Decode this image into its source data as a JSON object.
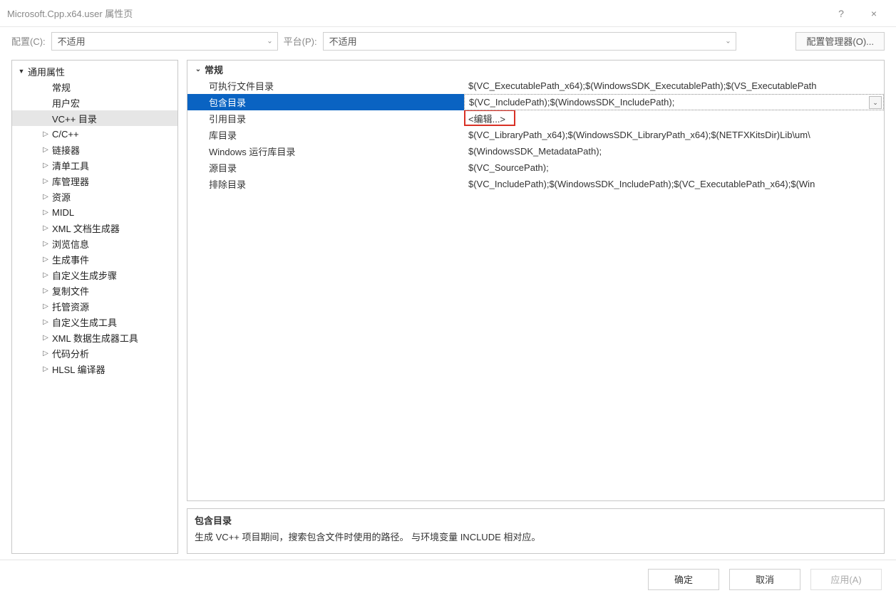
{
  "titlebar": {
    "title": "Microsoft.Cpp.x64.user 属性页",
    "help_icon": "?",
    "close_icon": "×"
  },
  "toolbar": {
    "config_label": "配置(C):",
    "config_value": "不适用",
    "platform_label": "平台(P):",
    "platform_value": "不适用",
    "config_manager": "配置管理器(O)..."
  },
  "tree": {
    "root": {
      "label": "通用属性",
      "expanded": true
    },
    "items": [
      {
        "label": "常规",
        "level": 2,
        "toggle": ""
      },
      {
        "label": "用户宏",
        "level": 2,
        "toggle": ""
      },
      {
        "label": "VC++ 目录",
        "level": 2,
        "toggle": "",
        "selected": true
      },
      {
        "label": "C/C++",
        "level": 2,
        "toggle": "▷"
      },
      {
        "label": "链接器",
        "level": 2,
        "toggle": "▷"
      },
      {
        "label": "清单工具",
        "level": 2,
        "toggle": "▷"
      },
      {
        "label": "库管理器",
        "level": 2,
        "toggle": "▷"
      },
      {
        "label": "资源",
        "level": 2,
        "toggle": "▷"
      },
      {
        "label": "MIDL",
        "level": 2,
        "toggle": "▷"
      },
      {
        "label": "XML 文档生成器",
        "level": 2,
        "toggle": "▷"
      },
      {
        "label": "浏览信息",
        "level": 2,
        "toggle": "▷"
      },
      {
        "label": "生成事件",
        "level": 2,
        "toggle": "▷"
      },
      {
        "label": "自定义生成步骤",
        "level": 2,
        "toggle": "▷"
      },
      {
        "label": "复制文件",
        "level": 2,
        "toggle": "▷"
      },
      {
        "label": "托管资源",
        "level": 2,
        "toggle": "▷"
      },
      {
        "label": "自定义生成工具",
        "level": 2,
        "toggle": "▷"
      },
      {
        "label": "XML 数据生成器工具",
        "level": 2,
        "toggle": "▷"
      },
      {
        "label": "代码分析",
        "level": 2,
        "toggle": "▷"
      },
      {
        "label": "HLSL 编译器",
        "level": 2,
        "toggle": "▷"
      }
    ]
  },
  "grid": {
    "category": "常规",
    "rows": [
      {
        "name": "可执行文件目录",
        "value": "$(VC_ExecutablePath_x64);$(WindowsSDK_ExecutablePath);$(VS_ExecutablePath"
      },
      {
        "name": "包含目录",
        "value": "$(VC_IncludePath);$(WindowsSDK_IncludePath);",
        "selected": true
      },
      {
        "name": "引用目录",
        "value": "<编辑...>",
        "edit_highlight": true
      },
      {
        "name": "库目录",
        "value": "$(VC_LibraryPath_x64);$(WindowsSDK_LibraryPath_x64);$(NETFXKitsDir)Lib\\um\\"
      },
      {
        "name": "Windows 运行库目录",
        "value": "$(WindowsSDK_MetadataPath);"
      },
      {
        "name": "源目录",
        "value": "$(VC_SourcePath);"
      },
      {
        "name": "排除目录",
        "value": "$(VC_IncludePath);$(WindowsSDK_IncludePath);$(VC_ExecutablePath_x64);$(Win"
      }
    ]
  },
  "description": {
    "title": "包含目录",
    "text": "生成 VC++ 项目期间，搜索包含文件时使用的路径。 与环境变量 INCLUDE 相对应。"
  },
  "footer": {
    "ok": "确定",
    "cancel": "取消",
    "apply": "应用(A)"
  },
  "glyphs": {
    "chev_down": "⌄",
    "tri_down": "▾",
    "tri_right": "▷",
    "tri_down_solid": "▼"
  }
}
